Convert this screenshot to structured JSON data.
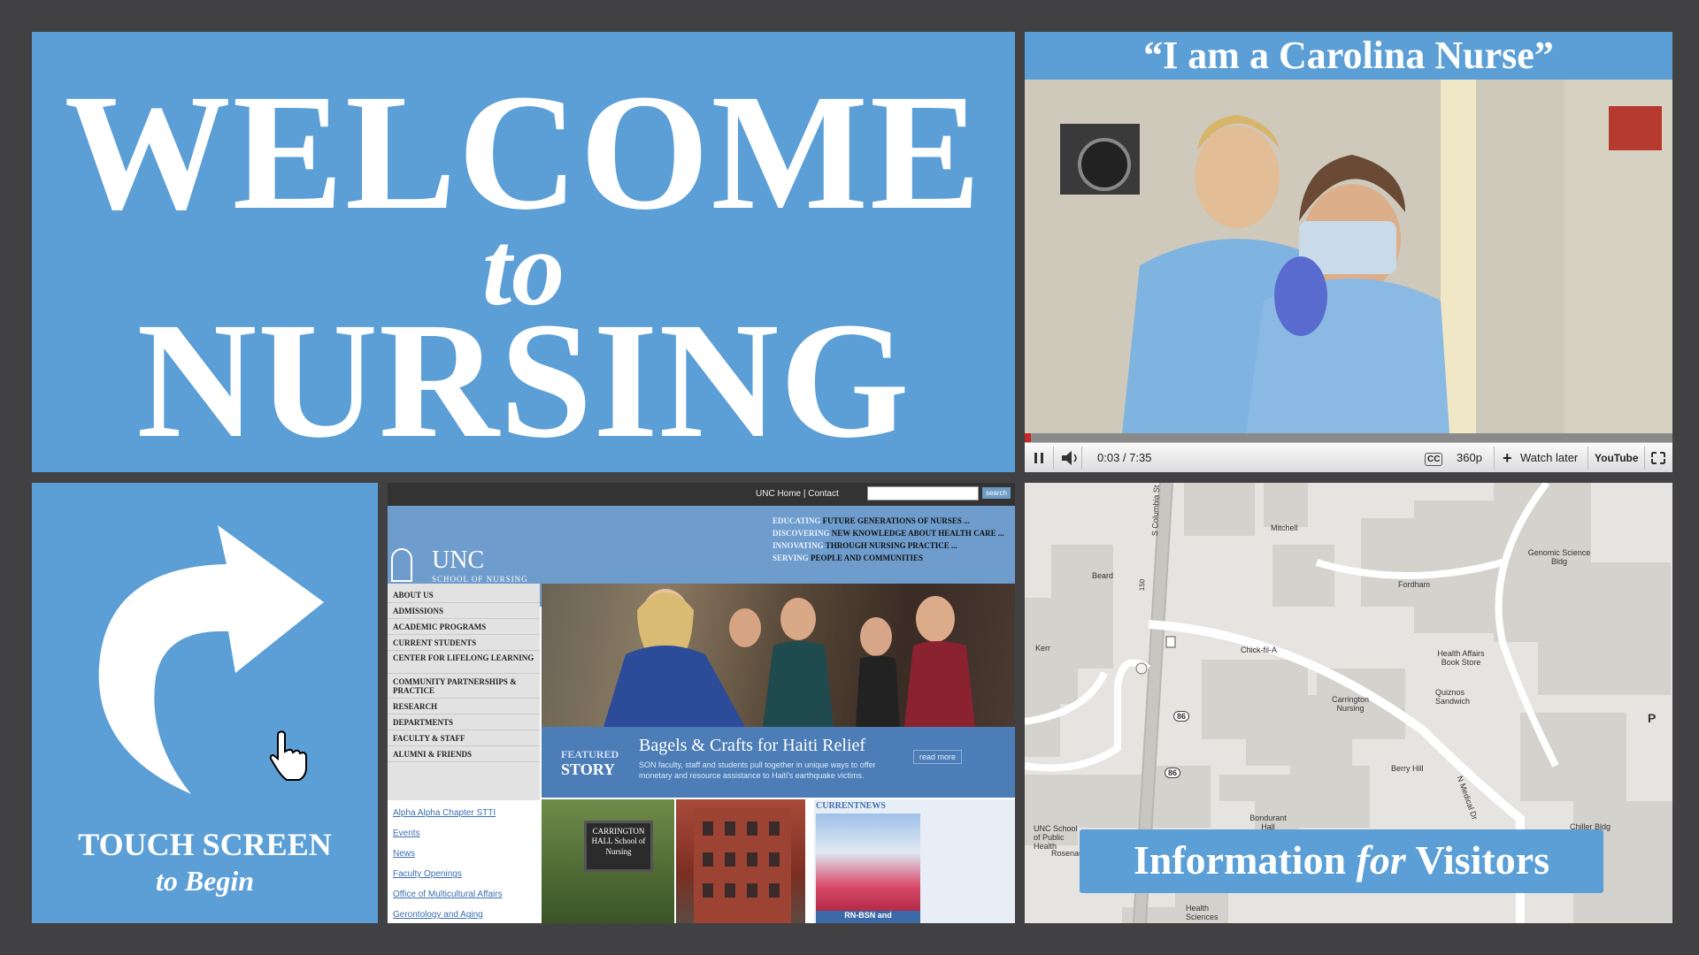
{
  "welcome": {
    "line1": "WELCOME",
    "line2": "to",
    "line3": "NURSING"
  },
  "video": {
    "title": "“I am a Carolina Nurse”",
    "time": "0:03 / 7:35",
    "cc": "CC",
    "quality": "360p",
    "watch_later": "Watch later",
    "youtube": "YouTube",
    "progress_fraction": 0.0067
  },
  "touch": {
    "line1": "TOUCH SCREEN",
    "line2": "to Begin"
  },
  "site": {
    "top_links": "UNC Home  |  Contact",
    "search_button": "search",
    "logo_title": "UNC",
    "logo_subtitle": "SCHOOL OF NURSING",
    "taglines": [
      {
        "k": "EDUCATING",
        "v": "FUTURE GENERATIONS OF NURSES ..."
      },
      {
        "k": "DISCOVERING",
        "v": "NEW KNOWLEDGE ABOUT HEALTH CARE ..."
      },
      {
        "k": "INNOVATING",
        "v": "THROUGH NURSING PRACTICE ..."
      },
      {
        "k": "SERVING",
        "v": "PEOPLE AND COMMUNITIES"
      }
    ],
    "nav": [
      "ABOUT US",
      "ADMISSIONS",
      "ACADEMIC PROGRAMS",
      "CURRENT STUDENTS",
      "CENTER FOR LIFELONG LEARNING",
      "COMMUNITY PARTNERSHIPS & PRACTICE",
      "RESEARCH",
      "DEPARTMENTS",
      "FACULTY & STAFF",
      "ALUMNI & FRIENDS"
    ],
    "links": [
      "Alpha Alpha Chapter STTI",
      "Events",
      "News",
      "Faculty Openings",
      "Office of Multicultural Affairs",
      "Gerontology and Aging"
    ],
    "featured_label_1": "FEATURED",
    "featured_label_2": "STORY",
    "story_title": "Bagels & Crafts for Haiti Relief",
    "story_desc": "SON faculty, staff and students pull together in unique ways to offer monetary and resource assistance to Haiti's earthquake victims.",
    "read_more": "read more",
    "sign_text": "CARRINGTON HALL School of Nursing",
    "current_news": "CURRENTNEWS",
    "news_caption": "RN-BSN and"
  },
  "map": {
    "labels": {
      "columbia": "S Columbia St",
      "mitchell": "Mitchell",
      "genomic": "Genomic Science Bldg",
      "beard": "Beard",
      "fordham": "Fordham",
      "kerr": "Kerr",
      "chickfila": "Chick-fil-A",
      "bookstore": "Health Affairs Book Store",
      "carrington": "Carrington Nursing",
      "quiznos": "Quiznos Sandwich",
      "r86a": "86",
      "r86b": "86",
      "berry": "Berry Hill",
      "medical": "N Medical Dr",
      "bondurant": "Bondurant Hall",
      "publichealth": "UNC School of Public Health",
      "rosenau": "Rosenau",
      "chiller": "Chiller Bldg",
      "health_sciences": "Health Sciences",
      "parking": "P",
      "r150": "150"
    },
    "info_prefix": "Information ",
    "info_for": "for",
    "info_suffix": " Visitors"
  }
}
